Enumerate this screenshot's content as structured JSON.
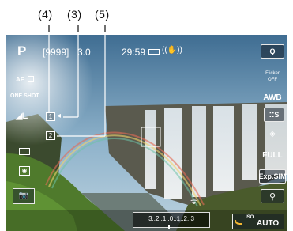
{
  "callouts": {
    "c4": "(4)",
    "c3": "(3)",
    "c5": "(5)"
  },
  "top_bar": {
    "mode": "P",
    "shots_remaining": "[9999]",
    "aperture": "3.0",
    "recording_time": "29:59",
    "battery_icon": "battery-icon",
    "stabilizer_icon": "image-stabilizer-icon"
  },
  "left_panel": {
    "af_method": "AF",
    "af_operation": "ONE SHOT",
    "image_quality": "L",
    "drive_icon": "drive-mode-icon",
    "metering_icon": "metering-icon",
    "camera_settings_icon": "camera-settings-icon"
  },
  "markers": {
    "frame1": "1",
    "frame2": "2"
  },
  "right_panel": {
    "q_button": "Q",
    "flicker": [
      "Flicker",
      "OFF"
    ],
    "white_balance": "AWB",
    "picture_style": "S",
    "creative_icon": "creative-filter-icon",
    "size": "FULL",
    "exposure_sim": "Exp.SIM",
    "zoom_icon": "magnify-icon"
  },
  "bottom_bar": {
    "exposure_scale": "3..2..1..0..1..2.:3",
    "iso_label": "ISO",
    "iso_value": "AUTO",
    "wifi_icon": "wifi-off-icon"
  }
}
